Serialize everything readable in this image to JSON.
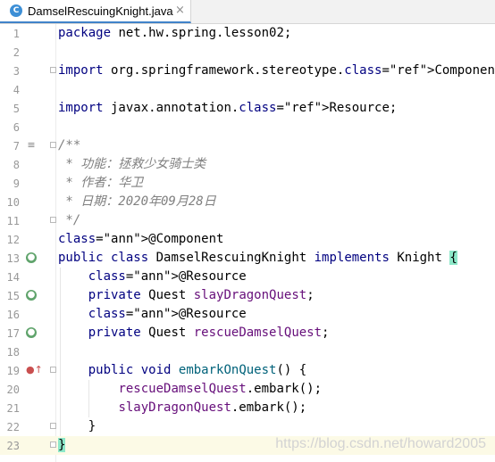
{
  "tab": {
    "icon": "C",
    "title": "DamselRescuingKnight.java",
    "close": "×"
  },
  "lines": [
    {
      "n": "1",
      "code": "package net.hw.spring.lesson02;"
    },
    {
      "n": "2",
      "code": ""
    },
    {
      "n": "3",
      "code": "import org.springframework.stereotype.Component;"
    },
    {
      "n": "4",
      "code": ""
    },
    {
      "n": "5",
      "code": "import javax.annotation.Resource;"
    },
    {
      "n": "6",
      "code": ""
    },
    {
      "n": "7",
      "code": "/**"
    },
    {
      "n": "8",
      "code": " * 功能：拯救少女骑士类"
    },
    {
      "n": "9",
      "code": " * 作者：华卫"
    },
    {
      "n": "10",
      "code": " * 日期：2020年09月28日"
    },
    {
      "n": "11",
      "code": " */"
    },
    {
      "n": "12",
      "code": "@Component"
    },
    {
      "n": "13",
      "code": "public class DamselRescuingKnight implements Knight {"
    },
    {
      "n": "14",
      "code": "    @Resource"
    },
    {
      "n": "15",
      "code": "    private Quest slayDragonQuest;"
    },
    {
      "n": "16",
      "code": "    @Resource"
    },
    {
      "n": "17",
      "code": "    private Quest rescueDamselQuest;"
    },
    {
      "n": "18",
      "code": ""
    },
    {
      "n": "19",
      "code": "    public void embarkOnQuest() {"
    },
    {
      "n": "20",
      "code": "        rescueDamselQuest.embark();"
    },
    {
      "n": "21",
      "code": "        slayDragonQuest.embark();"
    },
    {
      "n": "22",
      "code": "    }"
    },
    {
      "n": "23",
      "code": "}"
    }
  ],
  "gutter_icons": {
    "7": "structure-icon",
    "13": "spring-bean-icon",
    "15": "spring-bean-icon",
    "17": "spring-bean-icon",
    "19": "implements-method-icon"
  },
  "current_line": "23",
  "watermark": "https://blog.csdn.net/howard2005",
  "colors": {
    "keyword": "#000080",
    "annotation": "#808000",
    "field": "#660e7a",
    "method": "#00627a",
    "comment": "#808080",
    "line_number": "#999999",
    "current_line_bg": "#fcfae6",
    "brace_match": "#8de8c9"
  }
}
